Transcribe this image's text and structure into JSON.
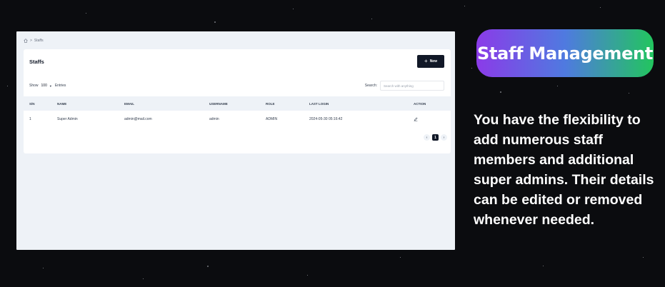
{
  "app": {
    "breadcrumb": {
      "current": "Staffs"
    },
    "card": {
      "title": "Staffs",
      "new_button_label": "New",
      "show_label": "Show",
      "entries_value": "100",
      "entries_label": "Entries",
      "search_label": "Search:",
      "search_placeholder": "Search with anything"
    },
    "table": {
      "headers": [
        "S/N",
        "NAME",
        "EMAIL",
        "USERNAME",
        "ROLE",
        "LAST LOGIN",
        "ACTION"
      ],
      "rows": [
        [
          "1",
          "Super Admin",
          "admin@mail.com",
          "admin",
          "ADMIN",
          "2024-05-30 05:16:42"
        ]
      ]
    },
    "pagination": {
      "prev": "‹",
      "current": "1",
      "next": "›"
    }
  },
  "promo": {
    "badge_title": "Staff Management",
    "description": "You have the flexibility to add numerous staff members and additional super admins. Their details can be edited or removed whenever needed."
  },
  "colors": {
    "background": "#0b0c0f",
    "accent_dark": "#111827",
    "badge_gradient_start": "#8b3be8",
    "badge_gradient_end": "#22c55e"
  },
  "icons": [
    "home-icon",
    "plus-icon",
    "chevron-down-icon",
    "edit-icon",
    "chevron-left-icon",
    "chevron-right-icon"
  ]
}
